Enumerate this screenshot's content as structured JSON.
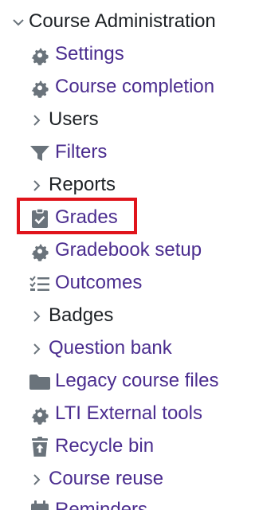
{
  "nav": {
    "root_label": "Course Administration",
    "items": [
      {
        "label": "Settings",
        "icon": "gear-icon"
      },
      {
        "label": "Course completion",
        "icon": "gear-icon"
      },
      {
        "label": "Users",
        "icon": "chevron-right-icon"
      },
      {
        "label": "Filters",
        "icon": "filter-icon"
      },
      {
        "label": "Reports",
        "icon": "chevron-right-icon"
      },
      {
        "label": "Grades",
        "icon": "clipboard-check-icon"
      },
      {
        "label": "Gradebook setup",
        "icon": "gear-icon"
      },
      {
        "label": "Outcomes",
        "icon": "checklist-icon"
      },
      {
        "label": "Badges",
        "icon": "chevron-right-icon"
      },
      {
        "label": "Question bank",
        "icon": "chevron-right-icon"
      },
      {
        "label": "Legacy course files",
        "icon": "folder-icon"
      },
      {
        "label": "LTI External tools",
        "icon": "gear-icon"
      },
      {
        "label": "Recycle bin",
        "icon": "trash-icon"
      },
      {
        "label": "Course reuse",
        "icon": "chevron-right-icon"
      },
      {
        "label": "Reminders",
        "icon": "calendar-icon"
      }
    ]
  },
  "colors": {
    "link": "#4b2d8f",
    "text": "#1d2125",
    "icon": "#6a737b",
    "highlight": "#e0141b"
  }
}
